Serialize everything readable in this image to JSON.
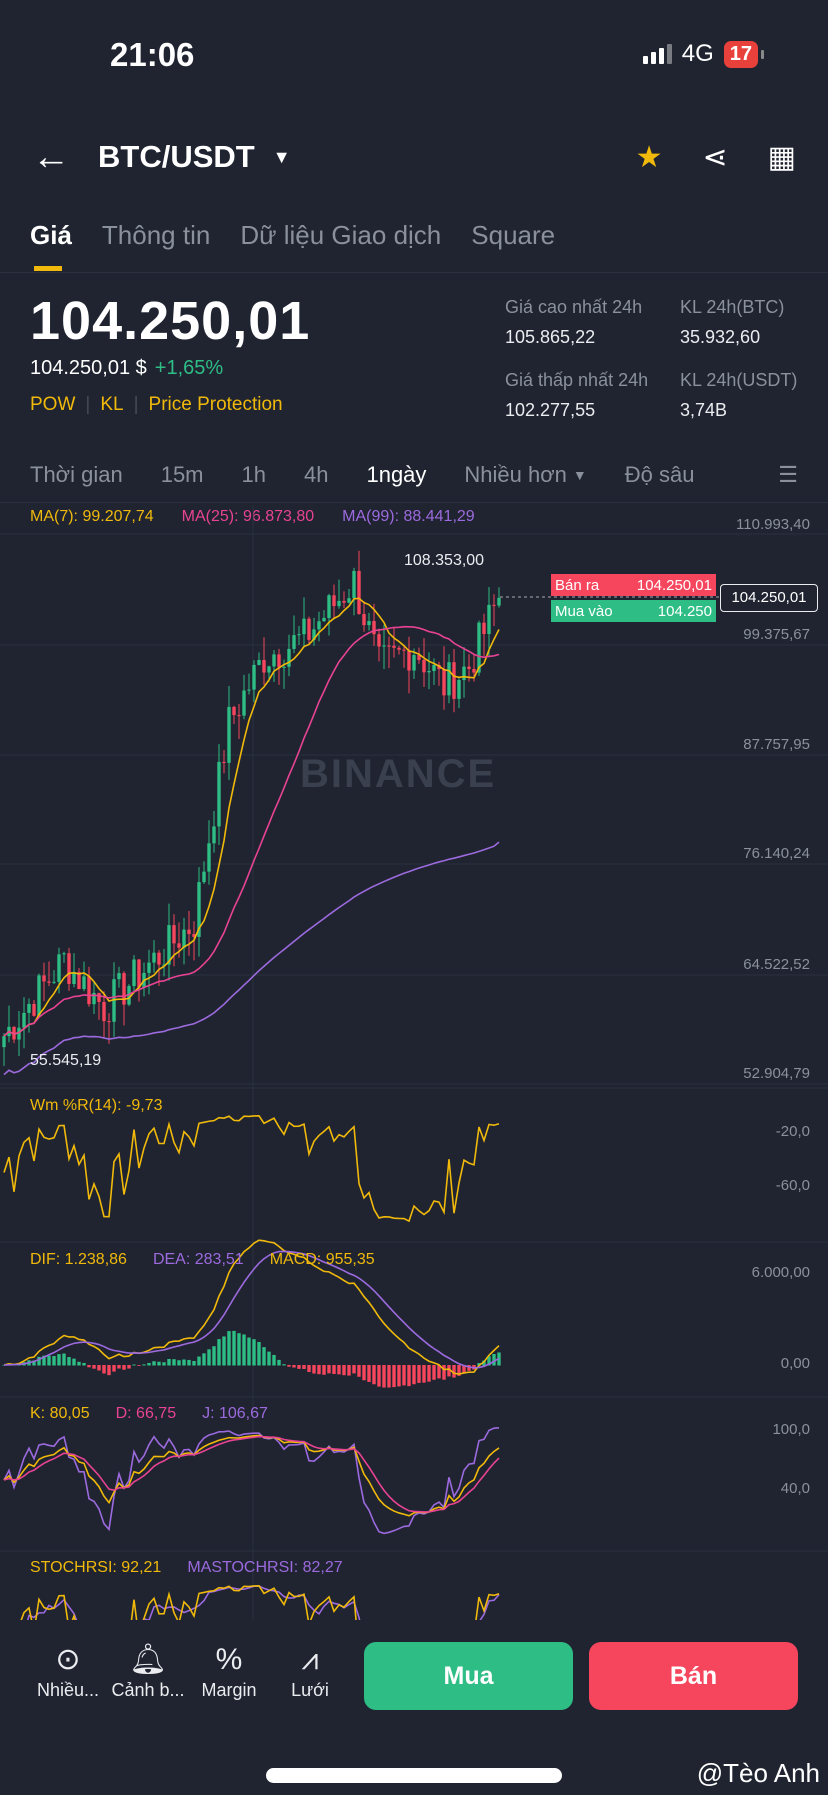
{
  "status": {
    "time": "21:06",
    "network": "4G",
    "battery": "17"
  },
  "header": {
    "pair": "BTC/USDT"
  },
  "tabs": [
    "Giá",
    "Thông tin",
    "Dữ liệu Giao dịch",
    "Square"
  ],
  "ticker": {
    "last": "104.250,01",
    "usd": "104.250,01 $",
    "change": "+1,65%",
    "tags": [
      "POW",
      "KL",
      "Price Protection"
    ],
    "high_label": "Giá cao nhất 24h",
    "high": "105.865,22",
    "low_label": "Giá thấp nhất 24h",
    "low": "102.277,55",
    "vol_btc_label": "KL 24h(BTC)",
    "vol_btc": "35.932,60",
    "vol_usdt_label": "KL 24h(USDT)",
    "vol_usdt": "3,74B"
  },
  "timeframes": [
    "Thời gian",
    "15m",
    "1h",
    "4h",
    "1ngày",
    "Nhiều hơn",
    "Độ sâu"
  ],
  "ma": {
    "ma7": "MA(7): 99.207,74",
    "ma25": "MA(25): 96.873,80",
    "ma99": "MA(99): 88.441,29"
  },
  "axis": [
    "110.993,40",
    "99.375,67",
    "87.757,95",
    "76.140,24",
    "64.522,52",
    "52.904,79"
  ],
  "chart": {
    "high_mark": "108.353,00",
    "low_mark": "55.545,19",
    "ask_label": "Bán ra",
    "ask": "104.250,01",
    "bid_label": "Mua vào",
    "bid": "104.250",
    "last": "104.250,01",
    "watermark": "BINANCE"
  },
  "wr": {
    "label": "Wm %R(14): -9,73",
    "axis": [
      "-20,0",
      "-60,0"
    ]
  },
  "macd": {
    "dif": "DIF: 1.238,86",
    "dea": "DEA: 283,51",
    "macd": "MACD: 955,35",
    "axis": [
      "6.000,00",
      "0,00"
    ]
  },
  "kdj": {
    "k": "K: 80,05",
    "d": "D: 66,75",
    "j": "J: 106,67",
    "axis": [
      "100,0",
      "40,0"
    ]
  },
  "stochrsi": {
    "s": "STOCHRSI: 92,21",
    "m": "MASTOCHRSI: 82,27"
  },
  "bottom": {
    "items": [
      "Nhiều...",
      "Cảnh b...",
      "Margin",
      "Lưới"
    ],
    "buy": "Mua",
    "sell": "Bán"
  },
  "watermark_user": "@Tèo Anh",
  "colors": {
    "up": "#2ebd85",
    "down": "#f6465d",
    "yellow": "#f0b90b",
    "pink": "#e84393",
    "purple": "#9c6ade"
  }
}
